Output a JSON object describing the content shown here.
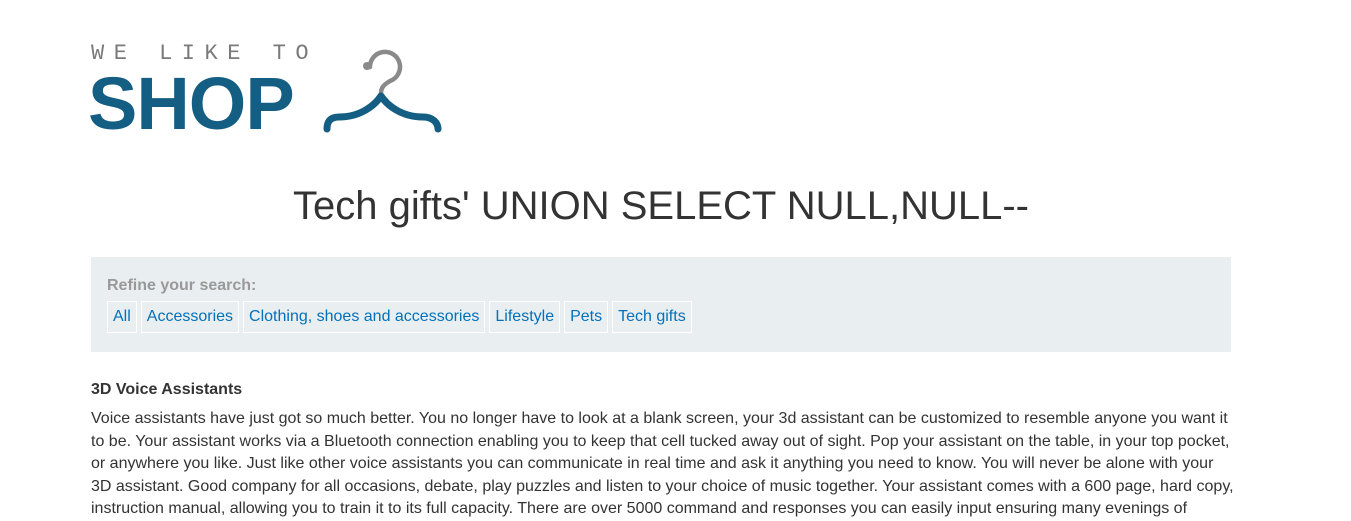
{
  "logo": {
    "top_text": "WE LIKE TO",
    "main_text": "SHOP",
    "icon": "hanger-icon"
  },
  "page_title": "Tech gifts' UNION SELECT NULL,NULL--",
  "filter": {
    "label": "Refine your search:",
    "links": [
      "All",
      "Accessories",
      "Clothing, shoes and accessories",
      "Lifestyle",
      "Pets",
      "Tech gifts"
    ]
  },
  "product": {
    "name": "3D Voice Assistants",
    "description": "Voice assistants have just got so much better. You no longer have to look at a blank screen, your 3d assistant can be customized to resemble anyone you want it to be. Your assistant works via a Bluetooth connection enabling you to keep that cell tucked away out of sight. Pop your assistant on the table, in your top pocket, or anywhere you like. Just like other voice assistants you can communicate in real time and ask it anything you need to know. You will never be alone with your 3D assistant. Good company for all occasions, debate, play puzzles and listen to your choice of music together. Your assistant comes with a 600 page, hard copy, instruction manual, allowing you to train it to its full capacity. There are over 5000 command and responses you can easily input ensuring many evenings of"
  },
  "colors": {
    "brand": "#155e83",
    "link": "#0071bc",
    "filter_bg": "#e9eef0"
  }
}
